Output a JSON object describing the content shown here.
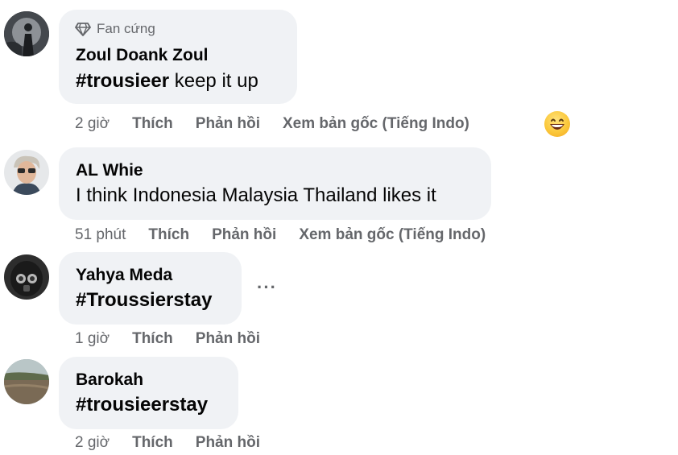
{
  "comments": [
    {
      "badge": "Fan cứng",
      "author": "Zoul Doank Zoul",
      "hashtag": "#trousieer",
      "text_rest": " keep it up",
      "time": "2 giờ",
      "like": "Thích",
      "reply": "Phản hồi",
      "see_original": "Xem bản gốc (Tiếng Indo)",
      "reaction_icon": "grinning-face-emoji"
    },
    {
      "author": "AL Whie",
      "text": "I think Indonesia Malaysia Thailand likes it",
      "time": "51 phút",
      "like": "Thích",
      "reply": "Phản hồi",
      "see_original": "Xem bản gốc (Tiếng Indo)"
    },
    {
      "author": "Yahya Meda",
      "hashtag": "#Troussierstay",
      "more_icon": "more-options-icon",
      "more_label": "···",
      "time": "1 giờ",
      "like": "Thích",
      "reply": "Phản hồi"
    },
    {
      "author": "Barokah",
      "hashtag": "#trousieerstay",
      "time": "2 giờ",
      "like": "Thích",
      "reply": "Phản hồi"
    }
  ],
  "colors": {
    "bubble": "#f0f2f5",
    "meta_text": "#65676b",
    "primary_text": "#050505"
  }
}
